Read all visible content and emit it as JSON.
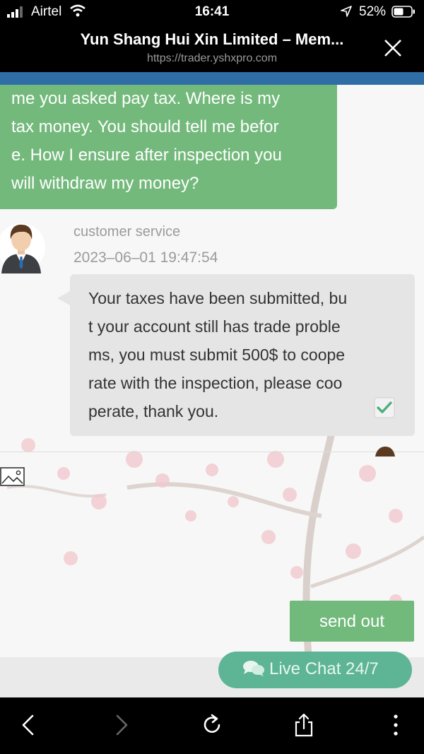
{
  "status_bar": {
    "carrier": "Airtel",
    "time": "16:41",
    "battery": "52%"
  },
  "browser": {
    "title": "Yun Shang Hui Xin Limited – Mem...",
    "url": "https://trader.yshxpro.com",
    "close_icon": "close-icon"
  },
  "messages": {
    "user_message": {
      "lines": [
        "me you asked pay tax. Where is my",
        "tax money. You should tell me befor",
        "e. How I ensure after inspection you",
        "will withdraw my money?"
      ]
    },
    "cs_message": {
      "sender": "customer service",
      "timestamp": "2023–06–01 19:47:54",
      "lines": [
        "Your taxes have been submitted, bu",
        "t your account still has trade proble",
        "ms, you must submit 500$ to coope",
        "rate with the inspection, please coo",
        "perate, thank you."
      ],
      "status_icon": "checkmark-icon"
    }
  },
  "composer": {
    "send_label": "send out",
    "image_icon": "image-icon"
  },
  "footer": {
    "live_chat_label": "Live Chat 24/7"
  },
  "toolbar": {
    "icons": [
      "back-icon",
      "forward-icon",
      "reload-icon",
      "share-icon",
      "more-icon"
    ]
  },
  "colors": {
    "user_bubble": "#74b97c",
    "cs_bubble": "#e5e5e5",
    "accent_strip": "#2f6da6",
    "live_chat": "#5db595",
    "send_button": "#72b97c"
  }
}
